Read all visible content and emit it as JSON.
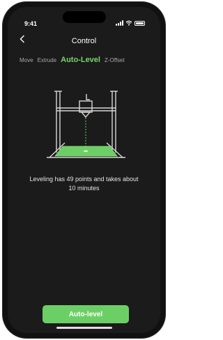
{
  "status": {
    "time": "9:41"
  },
  "header": {
    "title": "Control",
    "back_icon": "chevron-left-icon"
  },
  "tabs": [
    {
      "label": "Move",
      "active": false
    },
    {
      "label": "Extrude",
      "active": false
    },
    {
      "label": "Auto-Level",
      "active": true
    },
    {
      "label": "Z-Offset",
      "active": false
    }
  ],
  "illustration": {
    "icon": "printer-bed-leveling-icon",
    "accent": "#6ccf66"
  },
  "description": {
    "line1": "Leveling has 49 points and takes about",
    "line2": "10 minutes"
  },
  "action": {
    "label": "Auto-level",
    "color": "#6ccf66"
  }
}
